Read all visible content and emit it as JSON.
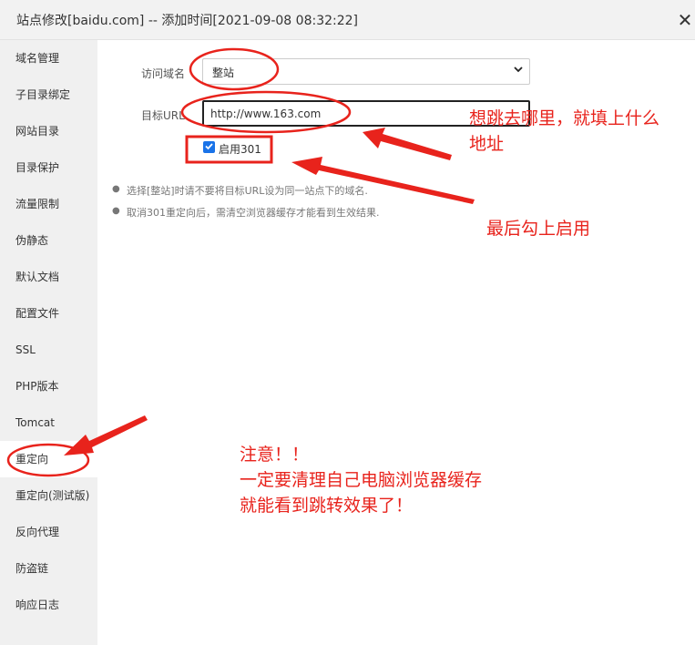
{
  "window": {
    "title": "站点修改[baidu.com] -- 添加时间[2021-09-08 08:32:22]",
    "close_glyph": "✕"
  },
  "sidebar": {
    "items": [
      {
        "label": "域名管理"
      },
      {
        "label": "子目录绑定"
      },
      {
        "label": "网站目录"
      },
      {
        "label": "目录保护"
      },
      {
        "label": "流量限制"
      },
      {
        "label": "伪静态"
      },
      {
        "label": "默认文档"
      },
      {
        "label": "配置文件"
      },
      {
        "label": "SSL"
      },
      {
        "label": "PHP版本"
      },
      {
        "label": "Tomcat"
      },
      {
        "label": "重定向",
        "active": true
      },
      {
        "label": "重定向(测试版)"
      },
      {
        "label": "反向代理"
      },
      {
        "label": "防盗链"
      },
      {
        "label": "响应日志"
      }
    ]
  },
  "form": {
    "domain_label": "访问域名",
    "domain_value": "整站",
    "url_label": "目标URL",
    "url_value": "http://www.163.com",
    "enable_label": "启用301",
    "enable_checked": true
  },
  "tips": [
    "选择[整站]时请不要将目标URL设为同一站点下的域名.",
    "取消301重定向后，需清空浏览器缓存才能看到生效结果."
  ],
  "annotations": {
    "fill_url_line1": "想跳去哪里，就填上什么",
    "fill_url_line2": "地址",
    "enable_last": "最后勾上启用",
    "note_line1": "注意！！",
    "note_line2": "一定要清理自己电脑浏览器缓存",
    "note_line3": "就能看到跳转效果了！",
    "color": "#e8231c"
  },
  "colors": {
    "titlebar_bg": "#f2f2f2",
    "sidebar_bg": "#f0f0f0",
    "checkbox_accent": "#1a73e8"
  },
  "icons": [
    "close-icon",
    "chevron-down-icon",
    "check-icon"
  ]
}
